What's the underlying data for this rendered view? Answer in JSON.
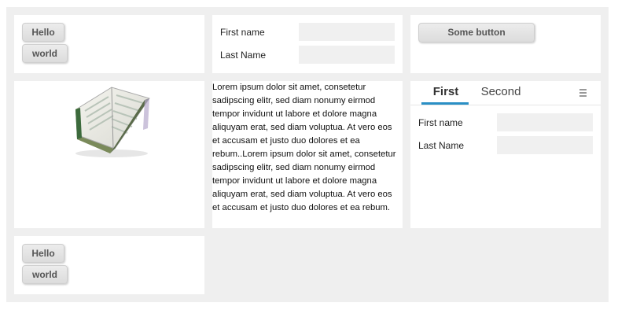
{
  "top_left": {
    "hello": "Hello",
    "world": "world"
  },
  "form": {
    "first_name_label": "First name",
    "last_name_label": "Last Name",
    "first_name_value": "",
    "last_name_value": ""
  },
  "some_button": "Some button",
  "lorem": "Lorem ipsum dolor sit amet, consetetur sadipscing elitr, sed diam nonumy eirmod tempor invidunt ut labore et dolore magna aliquyam erat, sed diam voluptua. At vero eos et accusam et justo duo dolores et ea rebum..Lorem ipsum dolor sit amet, consetetur sadipscing elitr, sed diam nonumy eirmod tempor invidunt ut labore et dolore magna aliquyam erat, sed diam voluptua. At vero eos et accusam et justo duo dolores et ea rebum.",
  "tabs": {
    "first": "First",
    "second": "Second",
    "active": "First",
    "accent": "#2a8fc5"
  },
  "tab_form": {
    "first_name_label": "First name",
    "last_name_label": "Last Name",
    "first_name_value": "",
    "last_name_value": ""
  },
  "bottom_left": {
    "hello": "Hello",
    "world": "world"
  },
  "icons": {
    "book": "open-book-icon",
    "menu": "hamburger-menu-icon"
  }
}
